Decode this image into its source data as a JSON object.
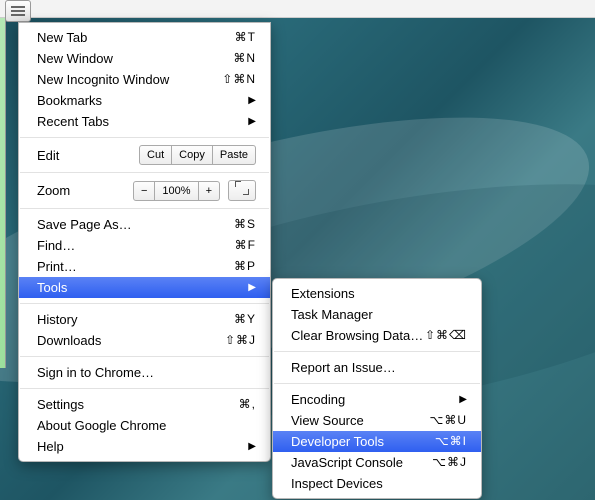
{
  "main_menu": {
    "new_tab": {
      "label": "New Tab",
      "shortcut": "⌘T"
    },
    "new_window": {
      "label": "New Window",
      "shortcut": "⌘N"
    },
    "new_incognito": {
      "label": "New Incognito Window",
      "shortcut": "⇧⌘N"
    },
    "bookmarks": {
      "label": "Bookmarks"
    },
    "recent_tabs": {
      "label": "Recent Tabs"
    },
    "edit": {
      "label": "Edit",
      "cut": "Cut",
      "copy": "Copy",
      "paste": "Paste"
    },
    "zoom": {
      "label": "Zoom",
      "minus": "−",
      "value": "100%",
      "plus": "+"
    },
    "save_page_as": {
      "label": "Save Page As…",
      "shortcut": "⌘S"
    },
    "find": {
      "label": "Find…",
      "shortcut": "⌘F"
    },
    "print": {
      "label": "Print…",
      "shortcut": "⌘P"
    },
    "tools": {
      "label": "Tools"
    },
    "history": {
      "label": "History",
      "shortcut": "⌘Y"
    },
    "downloads": {
      "label": "Downloads",
      "shortcut": "⇧⌘J"
    },
    "sign_in": {
      "label": "Sign in to Chrome…"
    },
    "settings": {
      "label": "Settings",
      "shortcut": "⌘,"
    },
    "about": {
      "label": "About Google Chrome"
    },
    "help": {
      "label": "Help"
    }
  },
  "sub_menu": {
    "extensions": {
      "label": "Extensions"
    },
    "task_manager": {
      "label": "Task Manager"
    },
    "clear_browsing": {
      "label": "Clear Browsing Data…",
      "shortcut": "⇧⌘⌫"
    },
    "report_issue": {
      "label": "Report an Issue…"
    },
    "encoding": {
      "label": "Encoding"
    },
    "view_source": {
      "label": "View Source",
      "shortcut": "⌥⌘U"
    },
    "developer_tools": {
      "label": "Developer Tools",
      "shortcut": "⌥⌘I"
    },
    "javascript_console": {
      "label": "JavaScript Console",
      "shortcut": "⌥⌘J"
    },
    "inspect_devices": {
      "label": "Inspect Devices"
    }
  }
}
